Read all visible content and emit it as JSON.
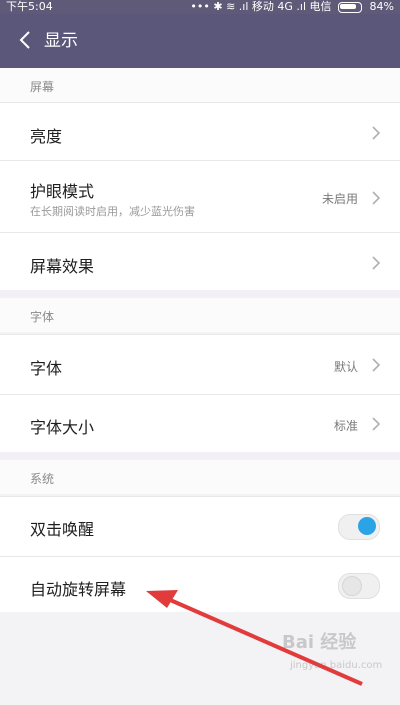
{
  "status_bar": {
    "time": "下午5:04",
    "right_text": "••• ✱ ≋ .ıl 移动 4G .ıl 电信",
    "battery": "84%"
  },
  "header": {
    "title": "显示"
  },
  "sections": [
    {
      "title": "屏幕",
      "rows": [
        {
          "label": "亮度"
        },
        {
          "label": "护眼模式",
          "sublabel": "在长期阅读时启用，减少蓝光伤害",
          "value": "未启用"
        },
        {
          "label": "屏幕效果"
        }
      ]
    },
    {
      "title": "字体",
      "rows": [
        {
          "label": "字体",
          "value": "默认"
        },
        {
          "label": "字体大小",
          "value": "标准"
        }
      ]
    },
    {
      "title": "系统",
      "rows": [
        {
          "label": "双击唤醒",
          "toggle": true
        },
        {
          "label": "自动旋转屏幕",
          "toggle": false
        }
      ]
    }
  ],
  "watermark": {
    "line1": "Bai 经验",
    "line2": "jingyan.baidu.com"
  },
  "colors": {
    "header_bg": "#5b577a",
    "toggle_on": "#2aa4e6",
    "arrow": "#e23b3b"
  },
  "icons": [
    "back-icon",
    "chevron-right-icon",
    "battery-icon",
    "toggle-switch"
  ]
}
